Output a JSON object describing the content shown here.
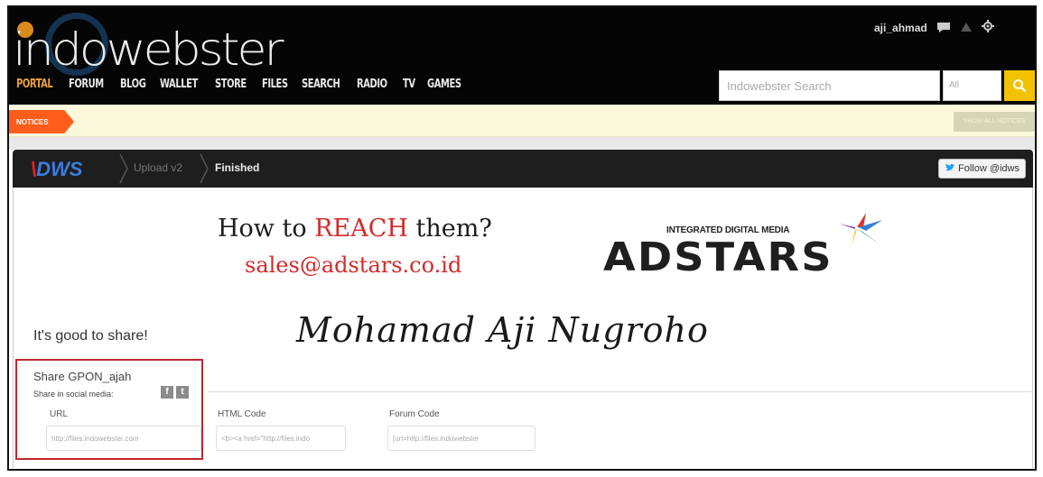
{
  "header": {
    "logo": "indowebster",
    "nav": [
      "PORTAL",
      "FORUM",
      "BLOG",
      "WALLET",
      "STORE",
      "FILES",
      "SEARCH",
      "RADIO",
      "TV",
      "GAMES"
    ],
    "search_placeholder": "Indowebster Search",
    "search_scope": "All",
    "username": "aji_ahmad"
  },
  "notices": {
    "tag": "NOTICES",
    "button": "SHOW ALL NOTICES"
  },
  "idws_bar": {
    "logo_mark": "\\",
    "logo_text": "DWS",
    "crumbs": [
      "Upload v2",
      "Finished"
    ],
    "follow": "Follow @idws"
  },
  "ad": {
    "line1_pre": "How to ",
    "line1_highlight": "REACH",
    "line1_post": " them?",
    "line2": "sales@adstars.co.id",
    "brand_small": "INTEGRATED DIGITAL MEDIA",
    "brand_big": "ADSTARS"
  },
  "content": {
    "share_heading": "It's good to share!",
    "signature": "Mohamad Aji Nugroho",
    "share_title": "Share GPON_ajah",
    "social_label": "Share in social media:",
    "fields": [
      {
        "label": "URL",
        "value": "http://files.indowebster.com"
      },
      {
        "label": "HTML Code",
        "value": "<b><a href=\"http://files.indo"
      },
      {
        "label": "Forum Code",
        "value": "[url=http://files.indowebster"
      }
    ]
  },
  "colors": {
    "header_bg": "#050505",
    "accent_orange": "#ff5d1a",
    "search_yellow": "#f2c200",
    "ad_red": "#d42a2a",
    "highlight_red": "#c0282e"
  }
}
